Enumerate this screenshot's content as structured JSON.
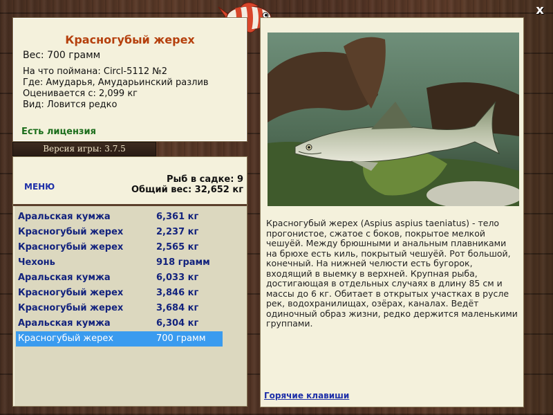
{
  "window": {
    "close_label": "x"
  },
  "fish": {
    "title": "Красногубый жерех",
    "weight": "Вес: 700 грамм",
    "caught_on": "На что поймана: Circl-5112 №2",
    "location": "Где: Амударья, Амударьинский разлив",
    "valued": "Оценивается с: 2,099 кг",
    "rarity": "Вид: Ловится редко",
    "license": "Есть лицензия"
  },
  "game": {
    "version": "Версия игры: 3.7.5"
  },
  "keepnet": {
    "menu_label": "МЕНЮ",
    "count": "Рыб в садке: 9",
    "total": "Общий вес: 32,652 кг",
    "rows": [
      {
        "name": "Аральская кумжа",
        "weight": "6,361 кг"
      },
      {
        "name": "Красногубый жерех",
        "weight": "2,237 кг"
      },
      {
        "name": "Красногубый жерех",
        "weight": "2,565 кг"
      },
      {
        "name": "Чехонь",
        "weight": "918 грамм"
      },
      {
        "name": "Аральская кумжа",
        "weight": "6,033 кг"
      },
      {
        "name": "Красногубый жерех",
        "weight": "3,846 кг"
      },
      {
        "name": "Красногубый жерех",
        "weight": "3,684 кг"
      },
      {
        "name": "Аральская кумжа",
        "weight": "6,304 кг"
      },
      {
        "name": "Красногубый жерех",
        "weight": "700 грамм"
      }
    ]
  },
  "description": "Красногубый жерех (Aspius aspius taeniatus) - тело прогонистое, сжатое с боков, покрытое мелкой чешуёй. Между брюшными и анальным плавниками на брюхе есть киль, покрытый чешуёй. Рот большой, конечный. На нижней челюсти есть бугорок, входящий в выемку в верхней. Крупная рыба, достигающая в отдельных случаях в длину 85 см и массы до 6 кг. Обитает в открытых участках в русле рек, водохранилищах, озёрах, каналах. Ведёт одиночный образ жизни, редко держится маленькими группами.",
  "hotkeys_label": "Горячие клавиши",
  "colors": {
    "title": "#b5400d",
    "license": "#1c6e1c",
    "list_text": "#13237d",
    "selection": "#3a9bef",
    "link": "#1d2fa8"
  }
}
